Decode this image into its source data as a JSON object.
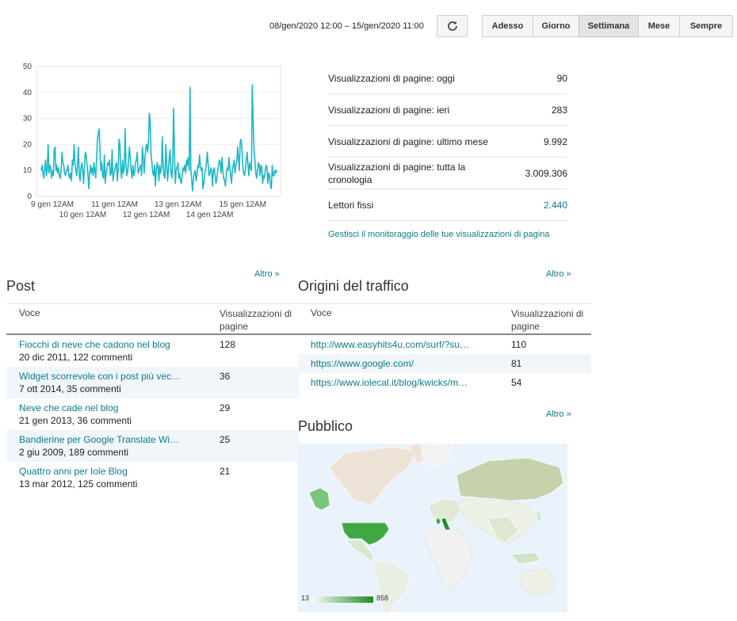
{
  "toolbar": {
    "date_range": "08/gen/2020 12:00 – 15/gen/2020 11:00",
    "ranges": [
      {
        "label": "Adesso",
        "active": false
      },
      {
        "label": "Giorno",
        "active": false
      },
      {
        "label": "Settimana",
        "active": true
      },
      {
        "label": "Mese",
        "active": false
      },
      {
        "label": "Sempre",
        "active": false
      }
    ]
  },
  "chart_data": {
    "type": "line",
    "ylim": [
      0,
      50
    ],
    "yticks": [
      "0",
      "10",
      "20",
      "30",
      "40",
      "50"
    ],
    "xticks_row1": [
      "9 gen 12AM",
      "11 gen 12AM",
      "13 gen 12AM",
      "15 gen 12AM"
    ],
    "xticks_row2": [
      "10 gen 12AM",
      "12 gen 12AM",
      "14 gen 12AM"
    ],
    "color": "#1cb8c9",
    "values": [
      10,
      12,
      9,
      7,
      11,
      14,
      8,
      10,
      20,
      9,
      12,
      11,
      7,
      10,
      8,
      18,
      19,
      10,
      12,
      9,
      11,
      8,
      7,
      10,
      17,
      13,
      12,
      9,
      8,
      10,
      10,
      12,
      8,
      7,
      9,
      6,
      14,
      12,
      20,
      13,
      10,
      8,
      12,
      19,
      8,
      6,
      11,
      13,
      10,
      5,
      12,
      17,
      16,
      12,
      9,
      3,
      8,
      12,
      9,
      11,
      8,
      13,
      10,
      7,
      15,
      22,
      24,
      26,
      18,
      10,
      13,
      8,
      7,
      16,
      5,
      9,
      11,
      13,
      12,
      14,
      8,
      9,
      18,
      6,
      9,
      10,
      12,
      13,
      6,
      11,
      22,
      20,
      10,
      7,
      14,
      9,
      11,
      26,
      12,
      8,
      10,
      14,
      19,
      15,
      10,
      7,
      12,
      8,
      9,
      13,
      14,
      17,
      9,
      10,
      11,
      12,
      8,
      19,
      15,
      9,
      15,
      19,
      20,
      17,
      22,
      32,
      29,
      16,
      13,
      9,
      8,
      12,
      4,
      10,
      13,
      11,
      6,
      12,
      9,
      11,
      23,
      12,
      8,
      7,
      20,
      13,
      6,
      10,
      15,
      18,
      10,
      7,
      12,
      34,
      18,
      5,
      10,
      11,
      13,
      7,
      9,
      6,
      5,
      8,
      11,
      10,
      12,
      9,
      14,
      12,
      15,
      10,
      42,
      11,
      6,
      2,
      7,
      9,
      10,
      6,
      8,
      12,
      11,
      16,
      12,
      10,
      11,
      3,
      5,
      9,
      10,
      13,
      17,
      12,
      8,
      9,
      11,
      10,
      4,
      10,
      11,
      8,
      5,
      7,
      10,
      12,
      14,
      13,
      9,
      15,
      10,
      7,
      6,
      4,
      9,
      11,
      10,
      15,
      11,
      8,
      5,
      10,
      12,
      14,
      9,
      12,
      13,
      19,
      15,
      10,
      21,
      22,
      19,
      12,
      9,
      8,
      10,
      14,
      17,
      12,
      8,
      13,
      11,
      10,
      43,
      30,
      18,
      14,
      9,
      7,
      10,
      13,
      12,
      8,
      12,
      11,
      5,
      8,
      7,
      10,
      12,
      11,
      5,
      9,
      8,
      4,
      3,
      12,
      8,
      8,
      10,
      9,
      10,
      10
    ]
  },
  "stats": [
    {
      "label": "Visualizzazioni di pagine: oggi",
      "value": "90",
      "link": false
    },
    {
      "label": "Visualizzazioni di pagine: ieri",
      "value": "283",
      "link": false
    },
    {
      "label": "Visualizzazioni di pagine: ultimo mese",
      "value": "9.992",
      "link": false
    },
    {
      "label": "Visualizzazioni di pagine: tutta la cronologia",
      "value": "3.009.306",
      "link": false
    },
    {
      "label": "Lettori fissi",
      "value": "2.440",
      "link": true
    }
  ],
  "stats_manage_link": "Gestisci il monitoraggio delle tue visualizzazioni di pagina",
  "posts": {
    "title": "Post",
    "more": "Altro »",
    "col_item": "Voce",
    "col_views": "Visualizzazioni di pagine",
    "rows": [
      {
        "title": "Fiocchi di neve che cadono nel blog",
        "meta": "20 dic 2011, 122 commenti",
        "views": "128"
      },
      {
        "title": "Widget scorrevole con i post più vec…",
        "meta": "7 ott 2014, 35 commenti",
        "views": "36"
      },
      {
        "title": "Neve che cade nel blog",
        "meta": "21 gen 2013, 36 commenti",
        "views": "29"
      },
      {
        "title": "Bandierine per Google Translate Wi…",
        "meta": "2 giu 2009, 189 commenti",
        "views": "25"
      },
      {
        "title": "Quattro anni per Iole Blog",
        "meta": "13 mar 2012, 125 commenti",
        "views": "21"
      }
    ]
  },
  "traffic": {
    "title": "Origini del traffico",
    "more": "Altro »",
    "col_item": "Voce",
    "col_views": "Visualizzazioni di pagine",
    "rows": [
      {
        "url": "http://www.easyhits4u.com/surf/?su…",
        "views": "110"
      },
      {
        "url": "https://www.google.com/",
        "views": "81"
      },
      {
        "url": "https://www.iolecal.it/blog/kwicks/m…",
        "views": "54"
      }
    ]
  },
  "audience": {
    "title": "Pubblico",
    "more": "Altro »",
    "legend_min": "13",
    "legend_max": "858"
  }
}
